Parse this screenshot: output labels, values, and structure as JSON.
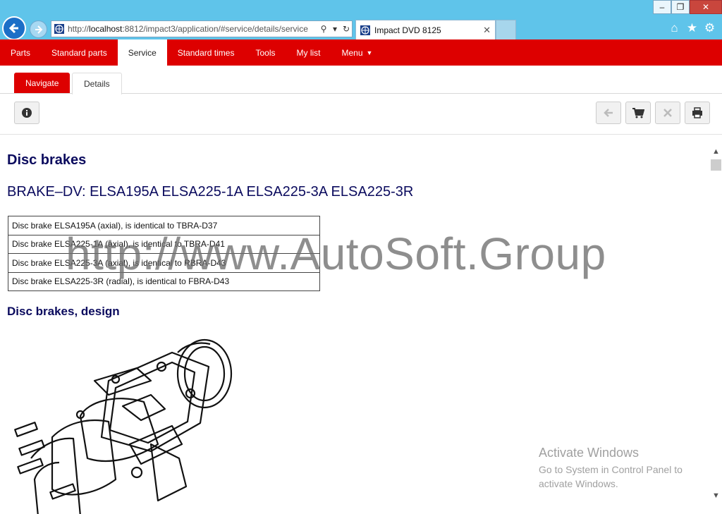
{
  "browser": {
    "url_prefix": "http://",
    "url_host": "localhost",
    "url_rest": ":8812/impact3/application/#service/details/service",
    "tab_title": "Impact DVD 8125",
    "window_controls": [
      "minimize-icon",
      "restore-icon",
      "close-icon"
    ]
  },
  "menu": {
    "items": [
      "Parts",
      "Standard parts",
      "Service",
      "Standard times",
      "Tools",
      "My list",
      "Menu"
    ],
    "active": "Service"
  },
  "subtabs": {
    "navigate": "Navigate",
    "details": "Details"
  },
  "document": {
    "title": "Disc brakes",
    "subtitle": "BRAKE–DV: ELSA195A ELSA225-1A ELSA225-3A ELSA225-3R",
    "table_rows": [
      "Disc brake ELSA195A (axial), is identical to TBRA-D37",
      "Disc brake ELSA225-1A (axial), is identical to TBRA-D41",
      "Disc brake ELSA225-3A (axial), is identical to RBRA-D43",
      "Disc brake ELSA225-3R (radial), is identical to FBRA-D43"
    ],
    "section_heading": "Disc brakes, design"
  },
  "overlay": {
    "watermark": "http://www.AutoSoft.Group",
    "activate_title": "Activate Windows",
    "activate_line1": "Go to System in Control Panel to",
    "activate_line2": "activate Windows."
  },
  "colors": {
    "accent": "#dd0000",
    "titlebar": "#5fc4ea",
    "heading": "#0b0b5e"
  }
}
